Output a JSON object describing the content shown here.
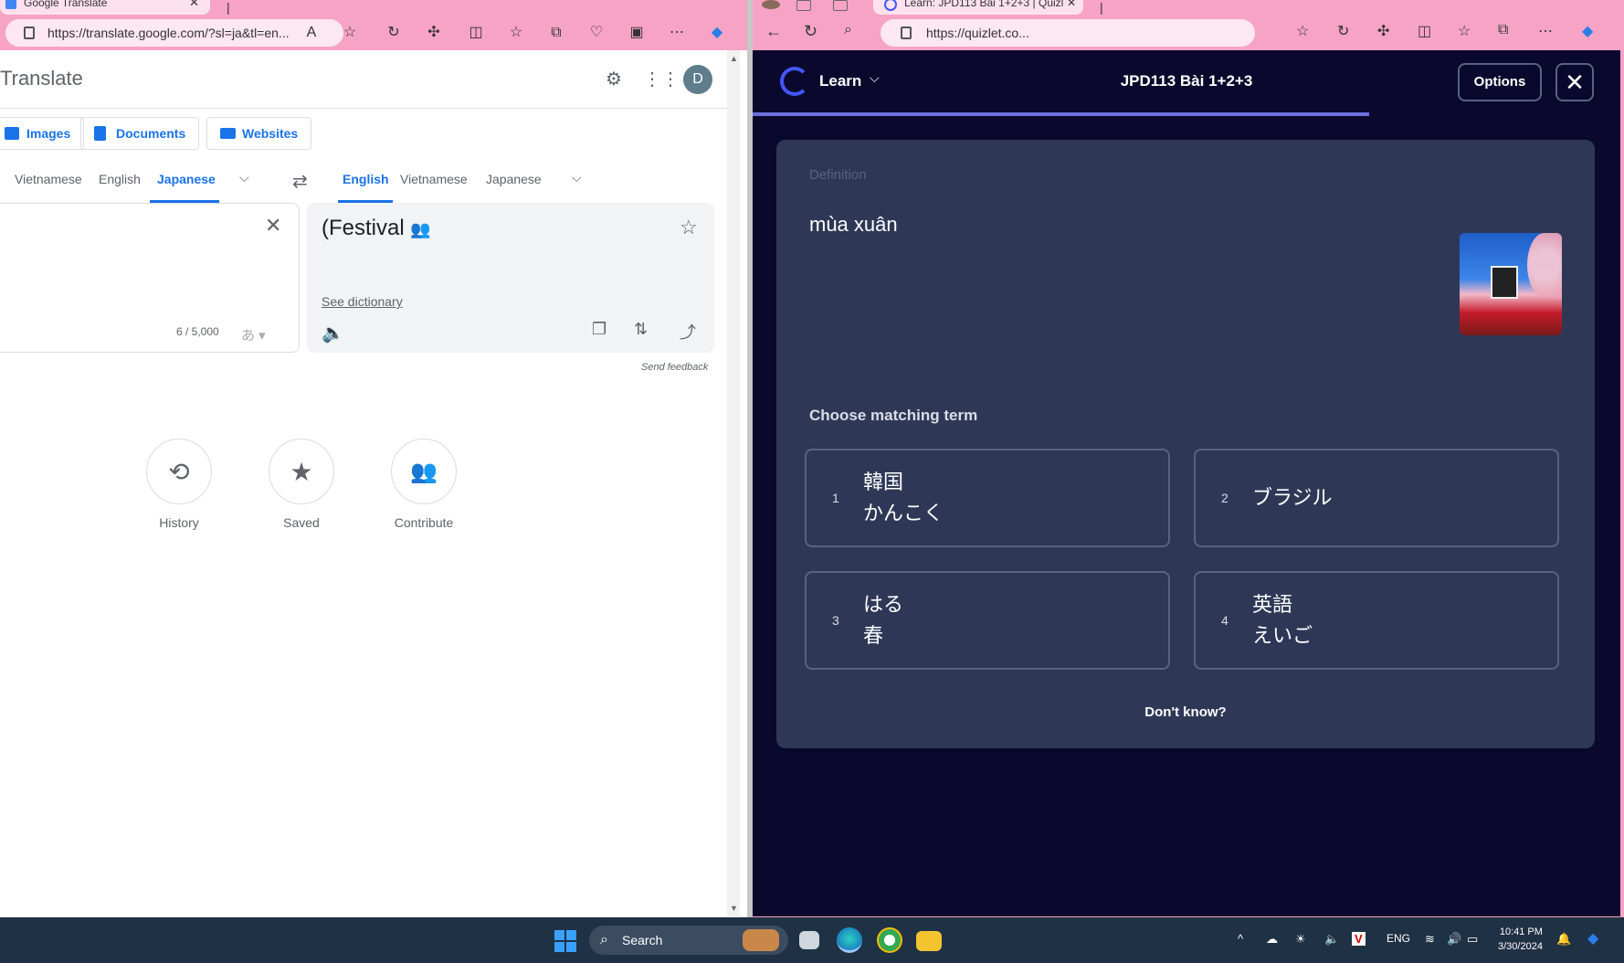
{
  "left": {
    "tab_title": "Google Translate",
    "url": "https://translate.google.com/?sl=ja&tl=en...",
    "app_title": "Translate",
    "avatar_letter": "D",
    "modes": [
      "Images",
      "Documents",
      "Websites"
    ],
    "source_langs": [
      "Vietnamese",
      "English",
      "Japanese"
    ],
    "target_langs": [
      "English",
      "Vietnamese",
      "Japanese"
    ],
    "char_count": "6 / 5,000",
    "ime_glyph": "あ",
    "translation": "(Festival",
    "see_dictionary": "See dictionary",
    "send_feedback": "Send feedback",
    "shortcuts": [
      "History",
      "Saved",
      "Contribute"
    ]
  },
  "right": {
    "tab_title": "Learn: JPD113 Bài 1+2+3 | Quizlet",
    "url": "https://quizlet.co...",
    "mode_label": "Learn",
    "set_title": "JPD113 Bài 1+2+3",
    "options_label": "Options",
    "definition_label": "Definition",
    "definition": "mùa xuân",
    "choose_label": "Choose matching term",
    "options": [
      {
        "num": "1",
        "line1": "韓国",
        "line2": "かんこく"
      },
      {
        "num": "2",
        "line1": "ブラジル",
        "line2": ""
      },
      {
        "num": "3",
        "line1": "はる",
        "line2": "春"
      },
      {
        "num": "4",
        "line1": "英語",
        "line2": "えいご"
      }
    ],
    "dont_know": "Don't know?",
    "progress": 0.71
  },
  "taskbar": {
    "search_label": "Search",
    "lang": "ENG",
    "time": "10:41 PM",
    "date": "3/30/2024"
  },
  "colors": {
    "quizlet_bg": "#0a092d",
    "quizlet_card": "#2e3856",
    "quizlet_accent": "#4255ff",
    "google_blue": "#1a73e8",
    "browser_frame": "#f6a3c6"
  }
}
